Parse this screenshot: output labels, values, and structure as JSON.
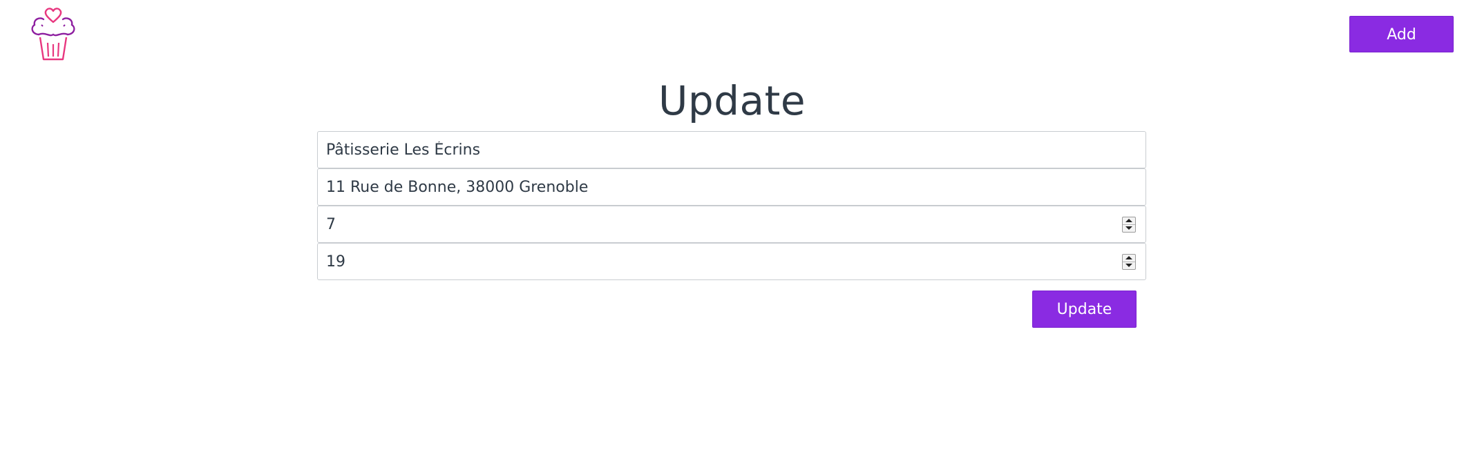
{
  "header": {
    "logo_icon": "cupcake-heart-icon",
    "add_label": "Add"
  },
  "page": {
    "title": "Update"
  },
  "form": {
    "name_value": "Pâtisserie Les Écrins",
    "address_value": "11 Rue de Bonne, 38000 Grenoble",
    "open_hour_value": "7",
    "close_hour_value": "19",
    "submit_label": "Update"
  },
  "colors": {
    "accent": "#8a2be2",
    "logo_pink": "#e8367f",
    "logo_purple": "#8e1fa0",
    "text": "#2f3a46"
  }
}
